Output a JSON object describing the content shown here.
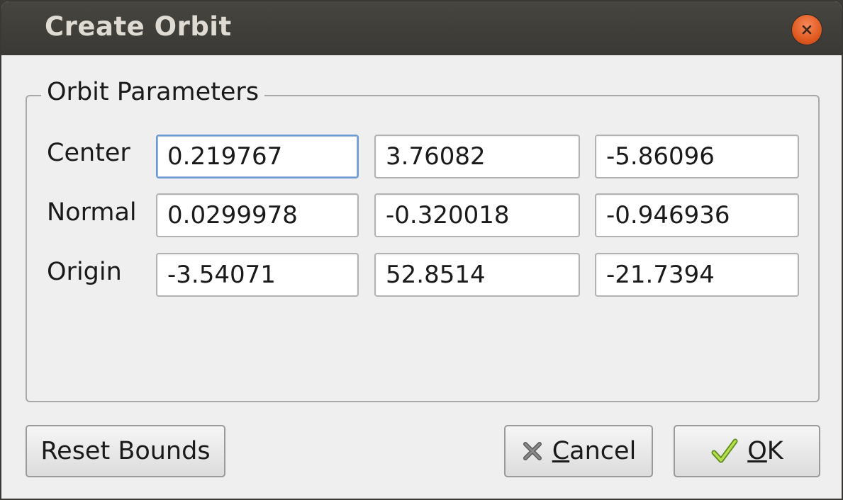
{
  "window": {
    "title": "Create Orbit"
  },
  "group": {
    "title": "Orbit Parameters",
    "rows": [
      {
        "label": "Center",
        "values": [
          "0.219767",
          "3.76082",
          "-5.86096"
        ]
      },
      {
        "label": "Normal",
        "values": [
          "0.0299978",
          "-0.320018",
          "-0.946936"
        ]
      },
      {
        "label": "Origin",
        "values": [
          "-3.54071",
          "52.8514",
          "-21.7394"
        ]
      }
    ]
  },
  "buttons": {
    "reset_label": "Reset Bounds",
    "cancel_mnemonic": "C",
    "cancel_rest": "ancel",
    "ok_mnemonic": "O",
    "ok_rest": "K"
  },
  "icons": {
    "close": "close-icon",
    "cancel": "x-icon",
    "ok": "checkmark-icon"
  },
  "colors": {
    "titlebar": "#3c3b37",
    "close_button": "#e05a1f",
    "focus_border": "#6e9ad4",
    "ok_check": "#8cc63f"
  }
}
